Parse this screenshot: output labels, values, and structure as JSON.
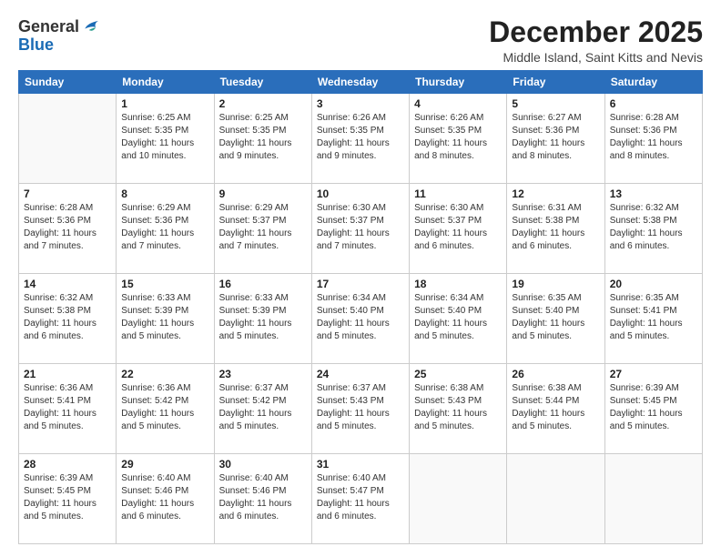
{
  "logo": {
    "general": "General",
    "blue": "Blue"
  },
  "header": {
    "month": "December 2025",
    "location": "Middle Island, Saint Kitts and Nevis"
  },
  "weekdays": [
    "Sunday",
    "Monday",
    "Tuesday",
    "Wednesday",
    "Thursday",
    "Friday",
    "Saturday"
  ],
  "weeks": [
    [
      {
        "day": "",
        "info": ""
      },
      {
        "day": "1",
        "info": "Sunrise: 6:25 AM\nSunset: 5:35 PM\nDaylight: 11 hours\nand 10 minutes."
      },
      {
        "day": "2",
        "info": "Sunrise: 6:25 AM\nSunset: 5:35 PM\nDaylight: 11 hours\nand 9 minutes."
      },
      {
        "day": "3",
        "info": "Sunrise: 6:26 AM\nSunset: 5:35 PM\nDaylight: 11 hours\nand 9 minutes."
      },
      {
        "day": "4",
        "info": "Sunrise: 6:26 AM\nSunset: 5:35 PM\nDaylight: 11 hours\nand 8 minutes."
      },
      {
        "day": "5",
        "info": "Sunrise: 6:27 AM\nSunset: 5:36 PM\nDaylight: 11 hours\nand 8 minutes."
      },
      {
        "day": "6",
        "info": "Sunrise: 6:28 AM\nSunset: 5:36 PM\nDaylight: 11 hours\nand 8 minutes."
      }
    ],
    [
      {
        "day": "7",
        "info": "Sunrise: 6:28 AM\nSunset: 5:36 PM\nDaylight: 11 hours\nand 7 minutes."
      },
      {
        "day": "8",
        "info": "Sunrise: 6:29 AM\nSunset: 5:36 PM\nDaylight: 11 hours\nand 7 minutes."
      },
      {
        "day": "9",
        "info": "Sunrise: 6:29 AM\nSunset: 5:37 PM\nDaylight: 11 hours\nand 7 minutes."
      },
      {
        "day": "10",
        "info": "Sunrise: 6:30 AM\nSunset: 5:37 PM\nDaylight: 11 hours\nand 7 minutes."
      },
      {
        "day": "11",
        "info": "Sunrise: 6:30 AM\nSunset: 5:37 PM\nDaylight: 11 hours\nand 6 minutes."
      },
      {
        "day": "12",
        "info": "Sunrise: 6:31 AM\nSunset: 5:38 PM\nDaylight: 11 hours\nand 6 minutes."
      },
      {
        "day": "13",
        "info": "Sunrise: 6:32 AM\nSunset: 5:38 PM\nDaylight: 11 hours\nand 6 minutes."
      }
    ],
    [
      {
        "day": "14",
        "info": "Sunrise: 6:32 AM\nSunset: 5:38 PM\nDaylight: 11 hours\nand 6 minutes."
      },
      {
        "day": "15",
        "info": "Sunrise: 6:33 AM\nSunset: 5:39 PM\nDaylight: 11 hours\nand 5 minutes."
      },
      {
        "day": "16",
        "info": "Sunrise: 6:33 AM\nSunset: 5:39 PM\nDaylight: 11 hours\nand 5 minutes."
      },
      {
        "day": "17",
        "info": "Sunrise: 6:34 AM\nSunset: 5:40 PM\nDaylight: 11 hours\nand 5 minutes."
      },
      {
        "day": "18",
        "info": "Sunrise: 6:34 AM\nSunset: 5:40 PM\nDaylight: 11 hours\nand 5 minutes."
      },
      {
        "day": "19",
        "info": "Sunrise: 6:35 AM\nSunset: 5:40 PM\nDaylight: 11 hours\nand 5 minutes."
      },
      {
        "day": "20",
        "info": "Sunrise: 6:35 AM\nSunset: 5:41 PM\nDaylight: 11 hours\nand 5 minutes."
      }
    ],
    [
      {
        "day": "21",
        "info": "Sunrise: 6:36 AM\nSunset: 5:41 PM\nDaylight: 11 hours\nand 5 minutes."
      },
      {
        "day": "22",
        "info": "Sunrise: 6:36 AM\nSunset: 5:42 PM\nDaylight: 11 hours\nand 5 minutes."
      },
      {
        "day": "23",
        "info": "Sunrise: 6:37 AM\nSunset: 5:42 PM\nDaylight: 11 hours\nand 5 minutes."
      },
      {
        "day": "24",
        "info": "Sunrise: 6:37 AM\nSunset: 5:43 PM\nDaylight: 11 hours\nand 5 minutes."
      },
      {
        "day": "25",
        "info": "Sunrise: 6:38 AM\nSunset: 5:43 PM\nDaylight: 11 hours\nand 5 minutes."
      },
      {
        "day": "26",
        "info": "Sunrise: 6:38 AM\nSunset: 5:44 PM\nDaylight: 11 hours\nand 5 minutes."
      },
      {
        "day": "27",
        "info": "Sunrise: 6:39 AM\nSunset: 5:45 PM\nDaylight: 11 hours\nand 5 minutes."
      }
    ],
    [
      {
        "day": "28",
        "info": "Sunrise: 6:39 AM\nSunset: 5:45 PM\nDaylight: 11 hours\nand 5 minutes."
      },
      {
        "day": "29",
        "info": "Sunrise: 6:40 AM\nSunset: 5:46 PM\nDaylight: 11 hours\nand 6 minutes."
      },
      {
        "day": "30",
        "info": "Sunrise: 6:40 AM\nSunset: 5:46 PM\nDaylight: 11 hours\nand 6 minutes."
      },
      {
        "day": "31",
        "info": "Sunrise: 6:40 AM\nSunset: 5:47 PM\nDaylight: 11 hours\nand 6 minutes."
      },
      {
        "day": "",
        "info": ""
      },
      {
        "day": "",
        "info": ""
      },
      {
        "day": "",
        "info": ""
      }
    ]
  ]
}
